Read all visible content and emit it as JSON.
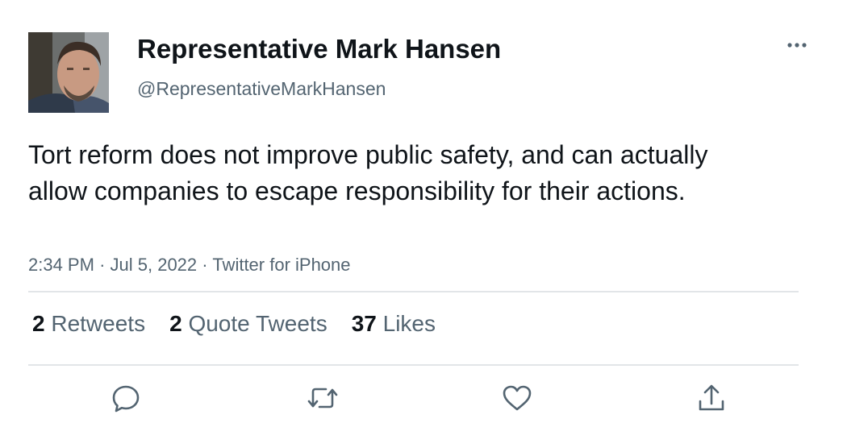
{
  "user": {
    "display_name": "Representative Mark Hansen",
    "handle": "@RepresentativeMarkHansen"
  },
  "tweet": {
    "text": "Tort reform does not improve public safety, and can actually allow companies to escape responsibility for their actions.",
    "time": "2:34 PM",
    "date": "Jul 5, 2022",
    "source": "Twitter for iPhone"
  },
  "stats": {
    "retweets": {
      "count": "2",
      "label": "Retweets"
    },
    "quote_tweets": {
      "count": "2",
      "label": "Quote Tweets"
    },
    "likes": {
      "count": "37",
      "label": "Likes"
    }
  },
  "icons": {
    "more": "more-horizontal-icon",
    "reply": "reply-icon",
    "retweet": "retweet-icon",
    "like": "heart-icon",
    "share": "share-icon"
  },
  "colors": {
    "text": "#0f1419",
    "secondary": "#536471",
    "divider": "#e2e5e8"
  }
}
